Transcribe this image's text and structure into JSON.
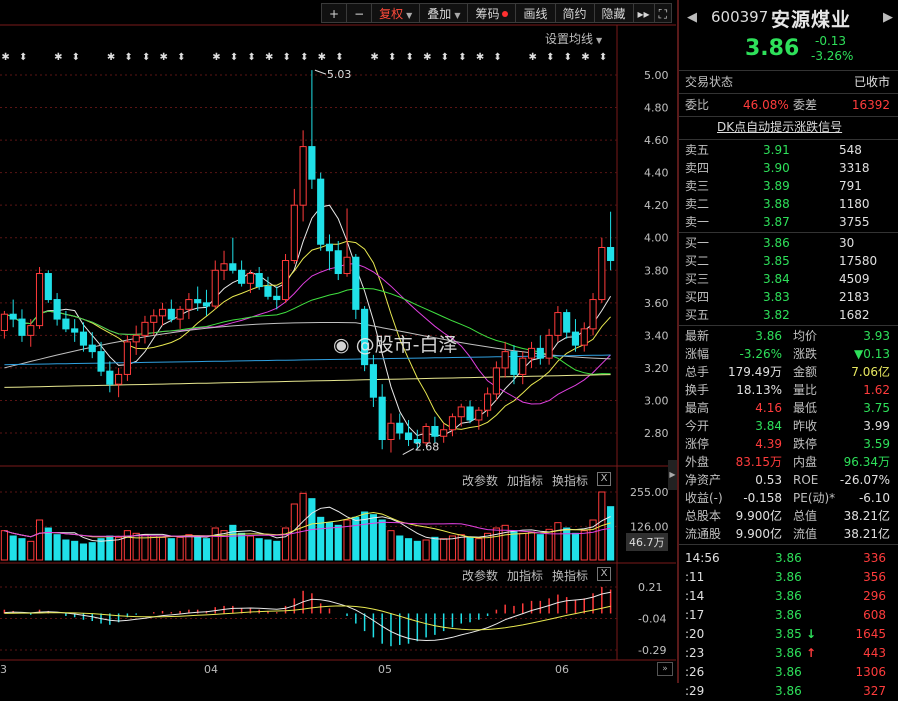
{
  "toolbar": {
    "plus": "+",
    "minus": "−",
    "fuquan": "复权",
    "overlay": "叠加",
    "chips": "筹码",
    "draw": "画线",
    "simple": "简约",
    "hide": "隐藏",
    "more": "▸▸",
    "expand": "⛶"
  },
  "ma_settings": "设置均线",
  "vol_panel": {
    "labels": [
      "改参数",
      "加指标",
      "换指标"
    ],
    "close": "X",
    "current": "46.7万"
  },
  "macd_panel": {
    "labels": [
      "改参数",
      "加指标",
      "换指标"
    ],
    "close": "X"
  },
  "watermark": "@股市-白泽",
  "price_axis": [
    "5.00",
    "4.80",
    "4.60",
    "4.40",
    "4.20",
    "4.00",
    "3.80",
    "3.60",
    "3.40",
    "3.20",
    "3.00",
    "2.80"
  ],
  "volume_axis": [
    "255.00",
    "126.00"
  ],
  "macd_axis": [
    "0.21",
    "-0.04",
    "-0.29"
  ],
  "x_labels": [
    "3",
    "04",
    "05",
    "06"
  ],
  "chart_data": {
    "type": "candlestick",
    "high_label": "5.03",
    "low_label": "2.68",
    "y_range": [
      2.68,
      5.05
    ],
    "candles": [
      [
        3.43,
        3.55,
        3.38,
        3.53
      ],
      [
        3.53,
        3.62,
        3.45,
        3.5
      ],
      [
        3.5,
        3.56,
        3.36,
        3.4
      ],
      [
        3.4,
        3.5,
        3.33,
        3.46
      ],
      [
        3.46,
        3.82,
        3.44,
        3.78
      ],
      [
        3.78,
        3.8,
        3.6,
        3.62
      ],
      [
        3.62,
        3.66,
        3.46,
        3.5
      ],
      [
        3.5,
        3.55,
        3.42,
        3.44
      ],
      [
        3.44,
        3.5,
        3.36,
        3.42
      ],
      [
        3.42,
        3.48,
        3.3,
        3.34
      ],
      [
        3.34,
        3.42,
        3.26,
        3.3
      ],
      [
        3.3,
        3.36,
        3.15,
        3.18
      ],
      [
        3.18,
        3.24,
        3.05,
        3.1
      ],
      [
        3.1,
        3.2,
        3.02,
        3.16
      ],
      [
        3.16,
        3.4,
        3.12,
        3.36
      ],
      [
        3.36,
        3.46,
        3.28,
        3.4
      ],
      [
        3.4,
        3.52,
        3.35,
        3.48
      ],
      [
        3.48,
        3.56,
        3.4,
        3.52
      ],
      [
        3.52,
        3.6,
        3.46,
        3.56
      ],
      [
        3.56,
        3.62,
        3.48,
        3.5
      ],
      [
        3.5,
        3.58,
        3.44,
        3.56
      ],
      [
        3.56,
        3.66,
        3.5,
        3.62
      ],
      [
        3.62,
        3.7,
        3.55,
        3.6
      ],
      [
        3.6,
        3.68,
        3.52,
        3.58
      ],
      [
        3.58,
        3.86,
        3.56,
        3.8
      ],
      [
        3.8,
        3.92,
        3.74,
        3.84
      ],
      [
        3.84,
        4.0,
        3.78,
        3.8
      ],
      [
        3.8,
        3.86,
        3.7,
        3.72
      ],
      [
        3.72,
        3.8,
        3.66,
        3.78
      ],
      [
        3.78,
        3.82,
        3.68,
        3.7
      ],
      [
        3.7,
        3.76,
        3.62,
        3.64
      ],
      [
        3.64,
        3.7,
        3.56,
        3.62
      ],
      [
        3.62,
        3.9,
        3.6,
        3.86
      ],
      [
        3.86,
        4.3,
        3.84,
        4.2
      ],
      [
        4.2,
        4.66,
        4.1,
        4.56
      ],
      [
        4.56,
        5.03,
        4.3,
        4.36
      ],
      [
        4.36,
        4.4,
        3.92,
        3.96
      ],
      [
        3.96,
        4.02,
        3.8,
        3.92
      ],
      [
        3.92,
        3.98,
        3.74,
        3.78
      ],
      [
        3.78,
        4.18,
        3.76,
        3.88
      ],
      [
        3.88,
        3.9,
        3.5,
        3.56
      ],
      [
        3.56,
        3.58,
        3.18,
        3.22
      ],
      [
        3.22,
        3.28,
        2.96,
        3.02
      ],
      [
        3.02,
        3.1,
        2.7,
        2.76
      ],
      [
        2.76,
        2.92,
        2.68,
        2.86
      ],
      [
        2.86,
        2.92,
        2.76,
        2.8
      ],
      [
        2.8,
        2.88,
        2.72,
        2.76
      ],
      [
        2.76,
        2.82,
        2.7,
        2.74
      ],
      [
        2.74,
        2.86,
        2.72,
        2.84
      ],
      [
        2.84,
        2.9,
        2.74,
        2.78
      ],
      [
        2.78,
        2.86,
        2.74,
        2.82
      ],
      [
        2.82,
        2.92,
        2.78,
        2.9
      ],
      [
        2.9,
        2.98,
        2.84,
        2.96
      ],
      [
        2.96,
        3.0,
        2.86,
        2.88
      ],
      [
        2.88,
        2.96,
        2.82,
        2.94
      ],
      [
        2.94,
        3.08,
        2.9,
        3.04
      ],
      [
        3.04,
        3.24,
        3.0,
        3.2
      ],
      [
        3.2,
        3.36,
        3.14,
        3.3
      ],
      [
        3.3,
        3.34,
        3.1,
        3.16
      ],
      [
        3.16,
        3.3,
        3.1,
        3.26
      ],
      [
        3.26,
        3.36,
        3.2,
        3.32
      ],
      [
        3.32,
        3.4,
        3.22,
        3.26
      ],
      [
        3.26,
        3.44,
        3.22,
        3.4
      ],
      [
        3.4,
        3.58,
        3.36,
        3.54
      ],
      [
        3.54,
        3.56,
        3.38,
        3.42
      ],
      [
        3.42,
        3.5,
        3.3,
        3.34
      ],
      [
        3.34,
        3.48,
        3.3,
        3.44
      ],
      [
        3.44,
        3.66,
        3.4,
        3.62
      ],
      [
        3.62,
        4.0,
        3.6,
        3.94
      ],
      [
        3.94,
        4.16,
        3.8,
        3.86
      ]
    ],
    "volume": [
      110,
      90,
      80,
      70,
      150,
      120,
      95,
      75,
      70,
      60,
      65,
      80,
      90,
      85,
      110,
      100,
      95,
      90,
      85,
      80,
      85,
      95,
      90,
      80,
      120,
      110,
      130,
      100,
      90,
      80,
      75,
      70,
      120,
      210,
      250,
      230,
      160,
      140,
      130,
      150,
      160,
      180,
      170,
      150,
      110,
      90,
      80,
      70,
      75,
      85,
      80,
      90,
      95,
      85,
      80,
      100,
      120,
      130,
      110,
      100,
      105,
      95,
      115,
      140,
      120,
      100,
      110,
      150,
      255,
      200
    ],
    "vol_up": [
      1,
      0,
      0,
      1,
      1,
      0,
      0,
      0,
      0,
      0,
      0,
      0,
      0,
      1,
      1,
      1,
      1,
      1,
      1,
      0,
      1,
      1,
      0,
      0,
      1,
      1,
      0,
      0,
      1,
      0,
      0,
      0,
      1,
      1,
      1,
      0,
      0,
      0,
      0,
      1,
      0,
      0,
      0,
      0,
      1,
      0,
      0,
      0,
      1,
      0,
      1,
      1,
      1,
      0,
      1,
      1,
      1,
      1,
      0,
      1,
      1,
      0,
      1,
      1,
      0,
      0,
      1,
      1,
      1,
      0
    ],
    "macd": [
      0.03,
      0.02,
      0.0,
      -0.01,
      0.03,
      0.02,
      0.0,
      -0.02,
      -0.03,
      -0.05,
      -0.06,
      -0.08,
      -0.09,
      -0.07,
      -0.03,
      -0.01,
      0.0,
      0.01,
      0.02,
      0.01,
      0.02,
      0.03,
      0.03,
      0.02,
      0.05,
      0.06,
      0.06,
      0.04,
      0.04,
      0.03,
      0.02,
      0.01,
      0.06,
      0.12,
      0.18,
      0.16,
      0.08,
      0.04,
      0.0,
      -0.02,
      -0.08,
      -0.14,
      -0.19,
      -0.24,
      -0.26,
      -0.25,
      -0.24,
      -0.22,
      -0.19,
      -0.17,
      -0.14,
      -0.11,
      -0.08,
      -0.07,
      -0.05,
      -0.02,
      0.03,
      0.07,
      0.06,
      0.08,
      0.1,
      0.1,
      0.12,
      0.15,
      0.13,
      0.11,
      0.12,
      0.16,
      0.21,
      0.19
    ]
  },
  "side": {
    "nav_left": "◀",
    "nav_right": "▶",
    "code": "600397",
    "name": "安源煤业",
    "price": "3.86",
    "change": "-0.13",
    "change_pct": "-3.26%",
    "status_label": "交易状态",
    "status_value": "已收市",
    "wb_label": "委比",
    "wb_value": "46.08%",
    "wc_label": "委差",
    "wc_value": "16392",
    "dk": "DK点自动提示涨跌信号",
    "asks": [
      {
        "l": "卖五",
        "p": "3.91",
        "v": "548"
      },
      {
        "l": "卖四",
        "p": "3.90",
        "v": "3318"
      },
      {
        "l": "卖三",
        "p": "3.89",
        "v": "791"
      },
      {
        "l": "卖二",
        "p": "3.88",
        "v": "1180"
      },
      {
        "l": "卖一",
        "p": "3.87",
        "v": "3755"
      }
    ],
    "bids": [
      {
        "l": "买一",
        "p": "3.86",
        "v": "30"
      },
      {
        "l": "买二",
        "p": "3.85",
        "v": "17580"
      },
      {
        "l": "买三",
        "p": "3.84",
        "v": "4509"
      },
      {
        "l": "买四",
        "p": "3.83",
        "v": "2183"
      },
      {
        "l": "买五",
        "p": "3.82",
        "v": "1682"
      }
    ],
    "stats": [
      {
        "l1": "最新",
        "v1": "3.86",
        "c1": "g",
        "l2": "均价",
        "v2": "3.93",
        "c2": "g"
      },
      {
        "l1": "涨幅",
        "v1": "-3.26%",
        "c1": "g",
        "l2": "涨跌",
        "v2": "▼0.13",
        "c2": "g"
      },
      {
        "l1": "总手",
        "v1": "179.49万",
        "c1": "w",
        "l2": "金额",
        "v2": "7.06亿",
        "c2": "y"
      },
      {
        "l1": "换手",
        "v1": "18.13%",
        "c1": "w",
        "l2": "量比",
        "v2": "1.62",
        "c2": "r"
      },
      {
        "l1": "最高",
        "v1": "4.16",
        "c1": "r",
        "l2": "最低",
        "v2": "3.75",
        "c2": "g"
      },
      {
        "l1": "今开",
        "v1": "3.84",
        "c1": "g",
        "l2": "昨收",
        "v2": "3.99",
        "c2": "w"
      },
      {
        "l1": "涨停",
        "v1": "4.39",
        "c1": "r",
        "l2": "跌停",
        "v2": "3.59",
        "c2": "g"
      },
      {
        "l1": "外盘",
        "v1": "83.15万",
        "c1": "r",
        "l2": "内盘",
        "v2": "96.34万",
        "c2": "g"
      },
      {
        "l1": "净资产",
        "v1": "0.53",
        "c1": "w",
        "l2": "ROE",
        "v2": "-26.07%",
        "c2": "w"
      },
      {
        "l1": "收益(-)",
        "v1": "-0.158",
        "c1": "w",
        "l2": "PE(动)*",
        "v2": "-6.10",
        "c2": "w"
      },
      {
        "l1": "总股本",
        "v1": "9.900亿",
        "c1": "w",
        "l2": "总值",
        "v2": "38.21亿",
        "c2": "w"
      },
      {
        "l1": "流通股",
        "v1": "9.900亿",
        "c1": "w",
        "l2": "流值",
        "v2": "38.21亿",
        "c2": "w"
      }
    ],
    "ticks": [
      {
        "t": "14:56",
        "p": "3.86",
        "v": "336",
        "arrow": ""
      },
      {
        "t": ":11",
        "p": "3.86",
        "v": "356",
        "arrow": ""
      },
      {
        "t": ":14",
        "p": "3.86",
        "v": "296",
        "arrow": ""
      },
      {
        "t": ":17",
        "p": "3.86",
        "v": "608",
        "arrow": ""
      },
      {
        "t": ":20",
        "p": "3.85",
        "v": "1645",
        "arrow": "down"
      },
      {
        "t": ":23",
        "p": "3.86",
        "v": "443",
        "arrow": "up"
      },
      {
        "t": ":26",
        "p": "3.86",
        "v": "1306",
        "arrow": ""
      },
      {
        "t": ":29",
        "p": "3.86",
        "v": "327",
        "arrow": ""
      }
    ]
  }
}
